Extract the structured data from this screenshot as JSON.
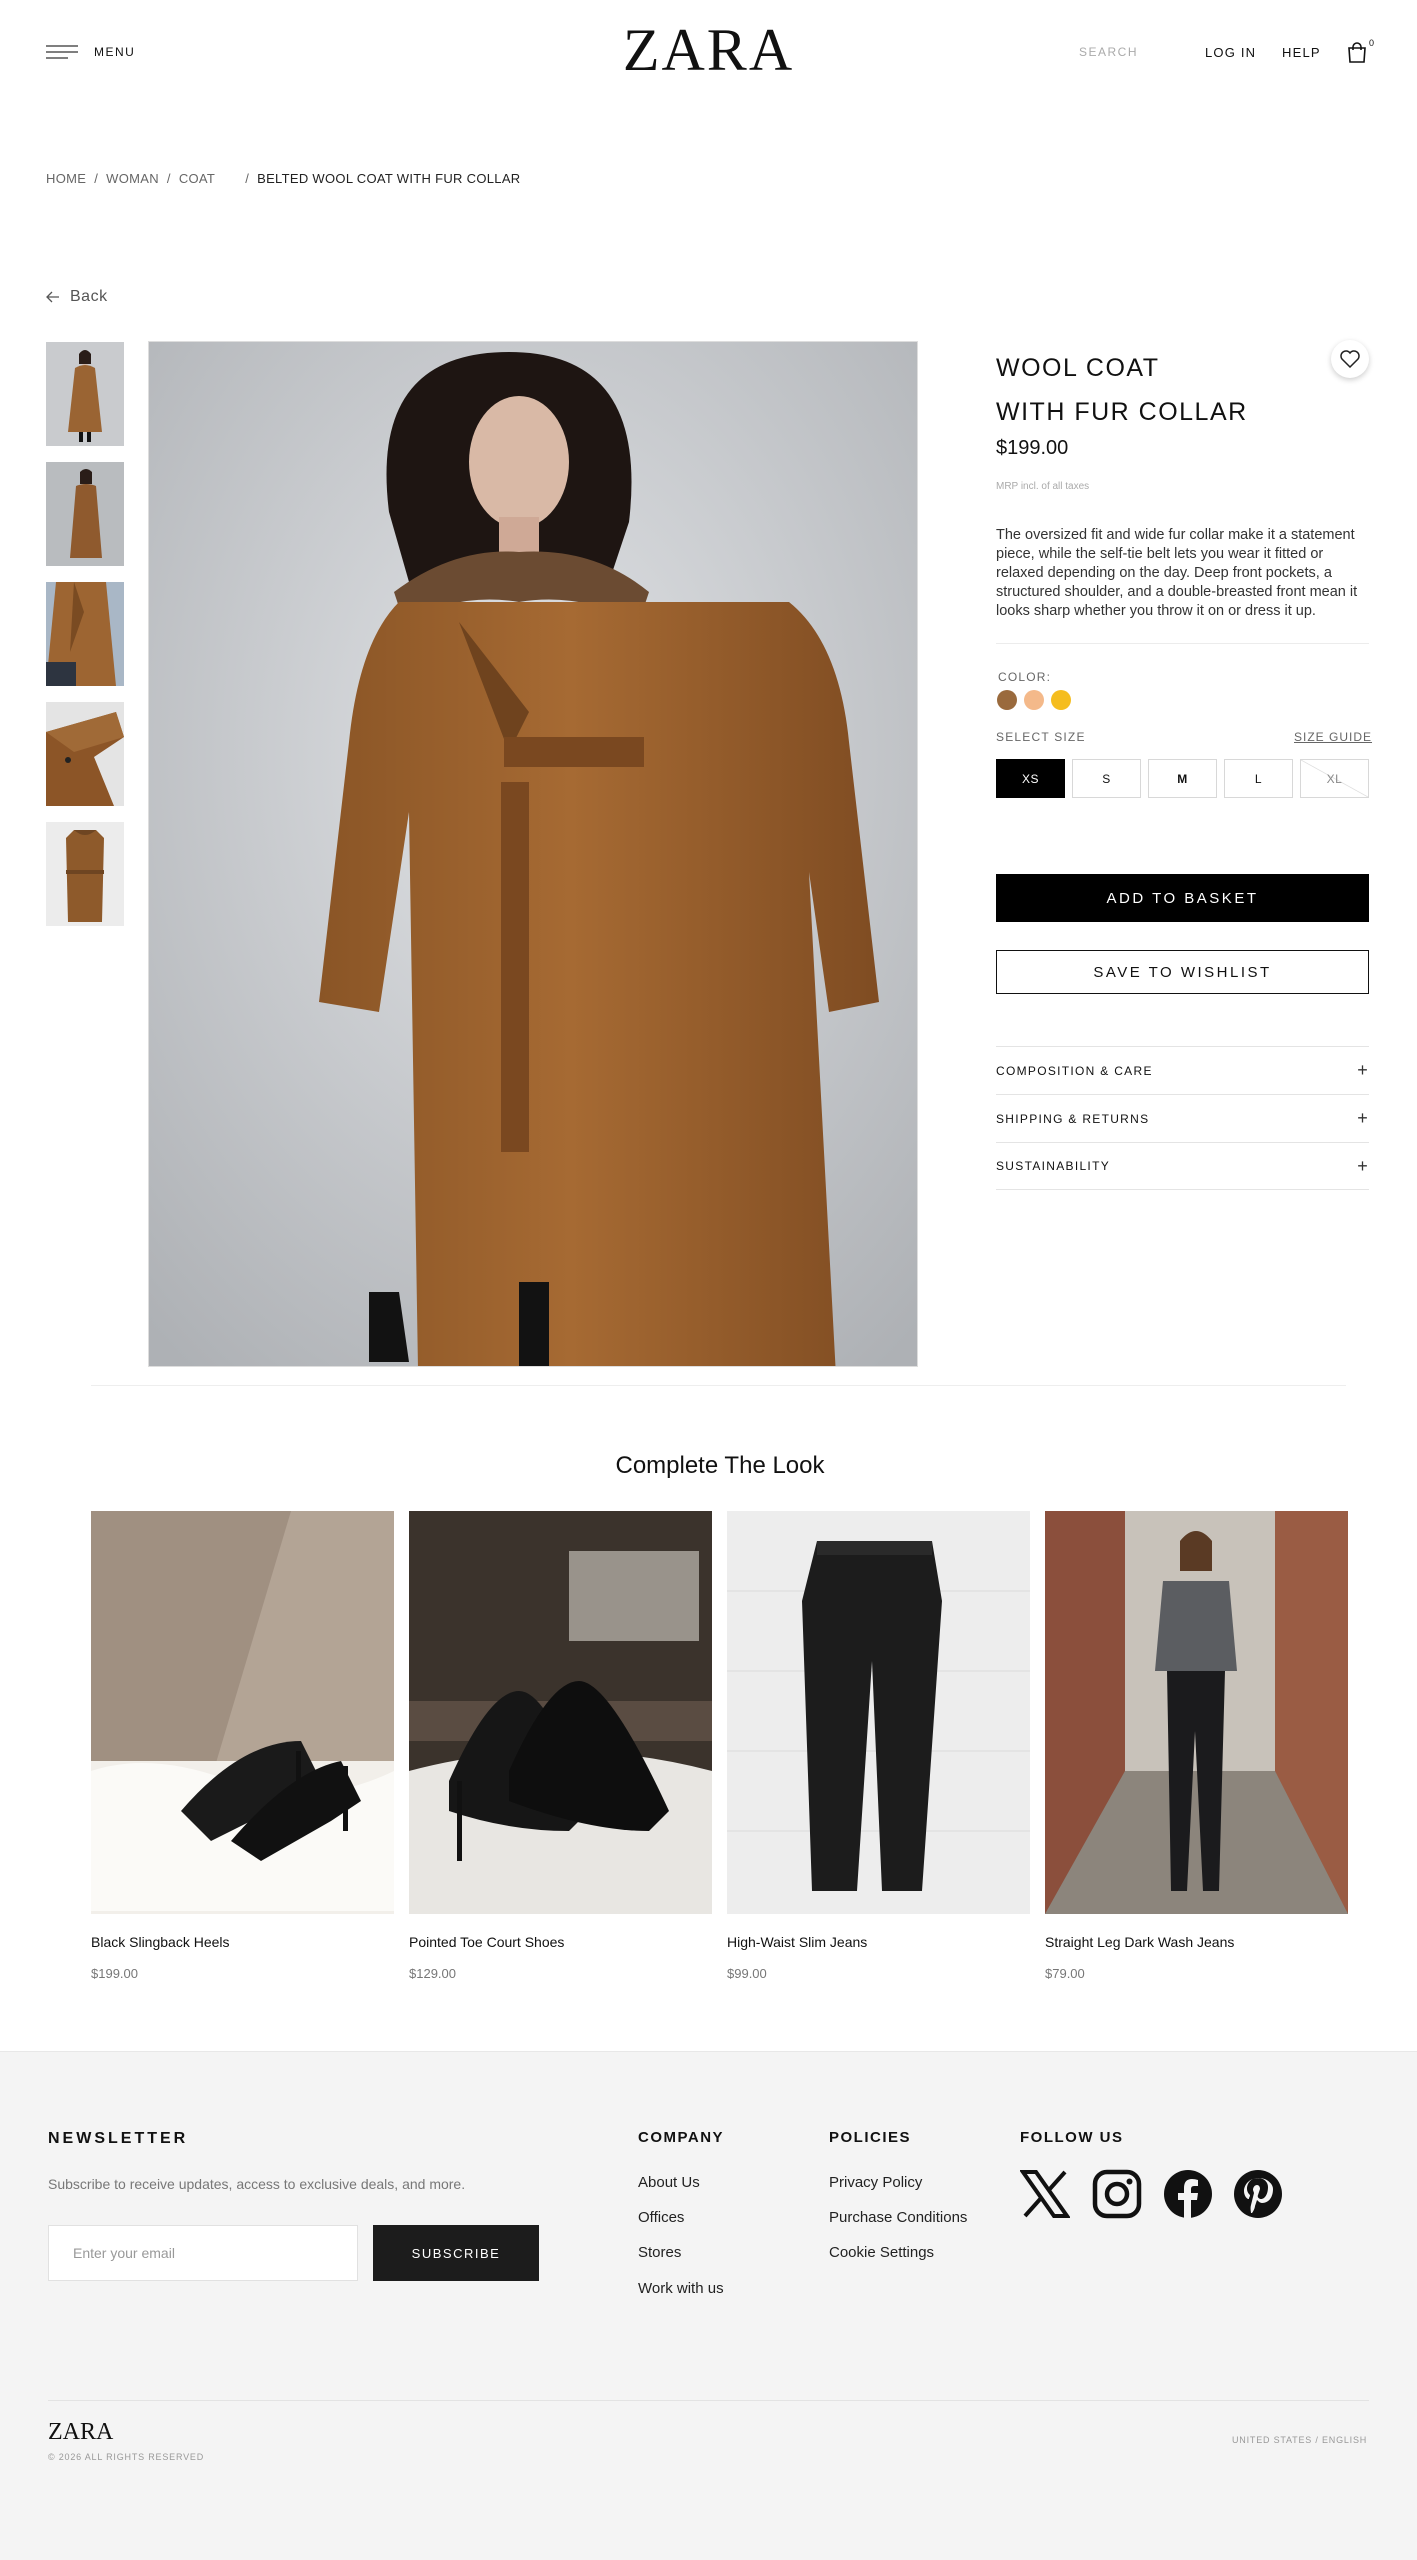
{
  "header": {
    "menu_label": "MENU",
    "logo": "ZARA",
    "search_placeholder": "SEARCH",
    "login": "LOG IN",
    "help": "HELP",
    "cart_count": "0"
  },
  "breadcrumb": {
    "items": [
      "HOME",
      "WOMAN",
      "COAT"
    ],
    "current": "BELTED WOOL COAT WITH FUR COLLAR"
  },
  "back_label": "Back",
  "product": {
    "title_line1": "WOOL COAT",
    "title_line2": "WITH FUR COLLAR",
    "price": "$199.00",
    "tax_note": "MRP incl. of all taxes",
    "description": "The oversized fit and wide fur collar make it a statement piece, while the self-tie belt lets you wear it fitted or relaxed depending on the day. Deep front pockets, a structured shoulder, and a double-breasted front mean it looks sharp whether you throw it on or dress it up.",
    "color_label": "COLOR:",
    "colors": [
      "#9a6a3d",
      "#f4b98a",
      "#f5bd1f"
    ],
    "size_label": "SELECT SIZE",
    "size_guide": "SIZE GUIDE",
    "sizes": [
      "XS",
      "S",
      "M",
      "L",
      "XL"
    ],
    "selected_size": "XS",
    "add_to_basket": "ADD TO BASKET",
    "save_to_wishlist": "SAVE TO WISHLIST",
    "accordions": [
      "COMPOSITION & CARE",
      "SHIPPING & RETURNS",
      "SUSTAINABILITY"
    ]
  },
  "look": {
    "title": "Complete The Look",
    "items": [
      {
        "name": "Black Slingback Heels",
        "price": "$199.00"
      },
      {
        "name": "Pointed Toe Court Shoes",
        "price": "$129.00"
      },
      {
        "name": "High-Waist Slim Jeans",
        "price": "$99.00"
      },
      {
        "name": "Straight Leg Dark Wash Jeans",
        "price": "$79.00"
      }
    ]
  },
  "footer": {
    "newsletter_title": "NEWSLETTER",
    "newsletter_text": "Subscribe to receive updates, access to exclusive deals, and more.",
    "email_placeholder": "Enter your email",
    "subscribe": "SUBSCRIBE",
    "company_title": "COMPANY",
    "company_links": [
      "About Us",
      "Offices",
      "Stores",
      "Work with us"
    ],
    "policies_title": "POLICIES",
    "policies_links": [
      "Privacy Policy",
      "Purchase Conditions",
      "Cookie Settings"
    ],
    "follow_title": "FOLLOW US",
    "social_icons": [
      "x-icon",
      "instagram-icon",
      "facebook-icon",
      "pinterest-icon"
    ],
    "logo": "ZARA",
    "copyright": "© 2026 ALL RIGHTS RESERVED",
    "locale": "UNITED STATES / ENGLISH"
  }
}
